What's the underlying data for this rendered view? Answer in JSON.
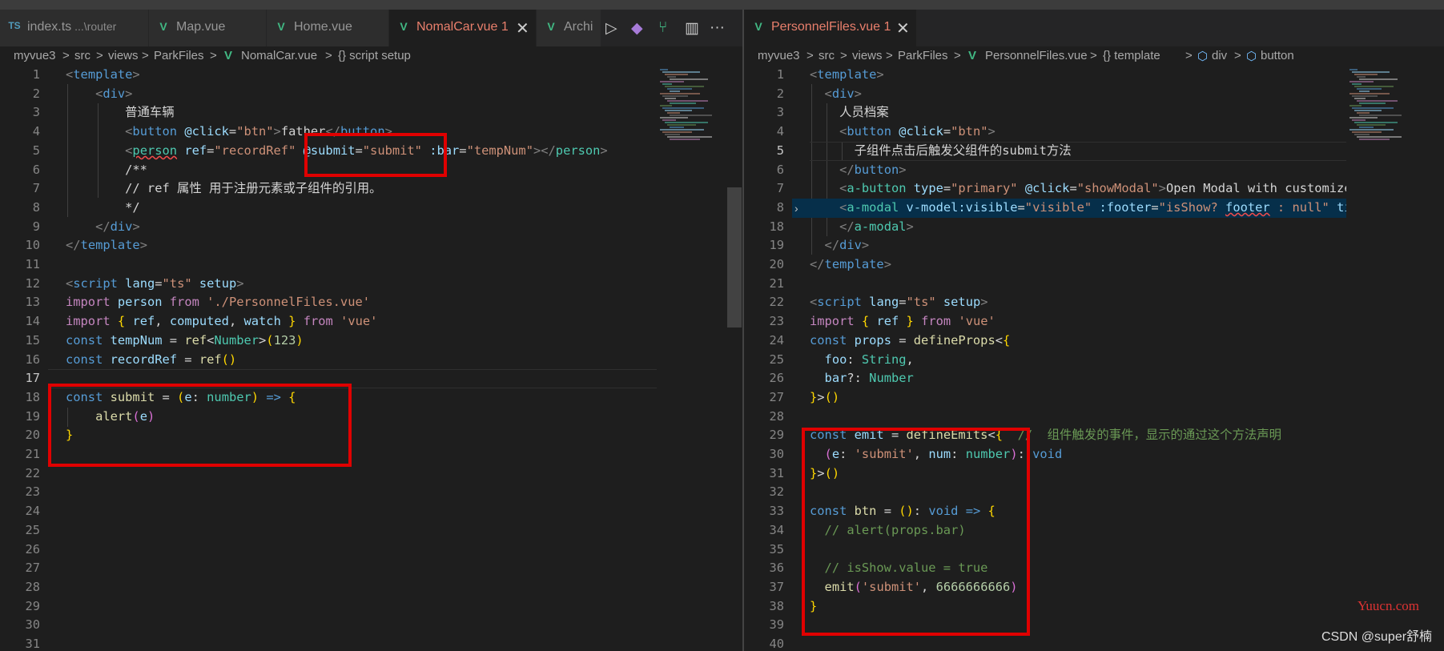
{
  "left": {
    "tabs": [
      {
        "icon": "TS",
        "label": "index.ts",
        "sub": "...\\router",
        "active": false
      },
      {
        "icon": "V",
        "label": "Map.vue",
        "active": false
      },
      {
        "icon": "V",
        "label": "Home.vue",
        "active": false
      },
      {
        "icon": "V",
        "label": "NomalCar.vue",
        "badge": "1",
        "active": true,
        "close": "✕"
      },
      {
        "icon": "V",
        "label": "Archi",
        "active": false
      }
    ],
    "actions": [
      "▷",
      "◆",
      "⑂",
      "▥",
      "···"
    ],
    "breadcrumb": [
      "myvue3",
      ">",
      "src",
      ">",
      "views",
      ">",
      "ParkFiles",
      ">",
      "NomalCar.vue",
      ">",
      "{} script setup"
    ],
    "line_numbers": [
      "1",
      "2",
      "3",
      "4",
      "5",
      "6",
      "7",
      "8",
      "9",
      "10",
      "11",
      "12",
      "13",
      "14",
      "15",
      "16",
      "17",
      "18",
      "19",
      "20",
      "21",
      "22",
      "23",
      "24",
      "25",
      "26",
      "27",
      "28",
      "29",
      "30",
      "31"
    ],
    "current_line": "17",
    "code": [
      [
        [
          "t",
          "<"
        ],
        [
          "tag",
          "template"
        ],
        [
          "t",
          ">"
        ]
      ],
      [
        [
          "txt",
          "    "
        ],
        [
          "t",
          "<"
        ],
        [
          "tag",
          "div"
        ],
        [
          "t",
          ">"
        ]
      ],
      [
        [
          "txt",
          "        普通车辆"
        ]
      ],
      [
        [
          "txt",
          "        "
        ],
        [
          "t",
          "<"
        ],
        [
          "tag",
          "button"
        ],
        [
          "txt",
          " "
        ],
        [
          "attr",
          "@click"
        ],
        [
          "txt",
          "="
        ],
        [
          "str",
          "\"btn\""
        ],
        [
          "t",
          ">"
        ],
        [
          "txt",
          "father"
        ],
        [
          "t",
          "</"
        ],
        [
          "tag",
          "button"
        ],
        [
          "t",
          ">"
        ]
      ],
      [
        [
          "txt",
          "        "
        ],
        [
          "t",
          "<"
        ],
        [
          "comp squig",
          "person"
        ],
        [
          "txt",
          " "
        ],
        [
          "attr",
          "ref"
        ],
        [
          "txt",
          "="
        ],
        [
          "str",
          "\"recordRef\""
        ],
        [
          "txt",
          " "
        ],
        [
          "attr",
          "@submit"
        ],
        [
          "txt",
          "="
        ],
        [
          "str",
          "\"submit\""
        ],
        [
          "txt",
          " "
        ],
        [
          "attr",
          ":bar"
        ],
        [
          "txt",
          "="
        ],
        [
          "str",
          "\"tempNum\""
        ],
        [
          "t",
          ">"
        ],
        [
          "t",
          "</"
        ],
        [
          "comp",
          "person"
        ],
        [
          "t",
          ">"
        ]
      ],
      [
        [
          "txt",
          "        "
        ],
        [
          "txt",
          "/**"
        ]
      ],
      [
        [
          "txt",
          "        // ref 属性 用于注册元素或子组件的引用。"
        ]
      ],
      [
        [
          "txt",
          "        */"
        ]
      ],
      [
        [
          "txt",
          "    "
        ],
        [
          "t",
          "</"
        ],
        [
          "tag",
          "div"
        ],
        [
          "t",
          ">"
        ]
      ],
      [
        [
          "t",
          "</"
        ],
        [
          "tag",
          "template"
        ],
        [
          "t",
          ">"
        ]
      ],
      [],
      [
        [
          "t",
          "<"
        ],
        [
          "tag",
          "script"
        ],
        [
          "txt",
          " "
        ],
        [
          "attr",
          "lang"
        ],
        [
          "txt",
          "="
        ],
        [
          "str",
          "\"ts\""
        ],
        [
          "txt",
          " "
        ],
        [
          "attr",
          "setup"
        ],
        [
          "t",
          ">"
        ]
      ],
      [
        [
          "kw2",
          "import"
        ],
        [
          "txt",
          " "
        ],
        [
          "var",
          "person"
        ],
        [
          "txt",
          " "
        ],
        [
          "kw2",
          "from"
        ],
        [
          "txt",
          " "
        ],
        [
          "str",
          "'./PersonnelFiles.vue'"
        ]
      ],
      [
        [
          "kw2",
          "import"
        ],
        [
          "txt",
          " "
        ],
        [
          "yb",
          "{"
        ],
        [
          "txt",
          " "
        ],
        [
          "var",
          "ref"
        ],
        [
          "txt",
          ", "
        ],
        [
          "var",
          "computed"
        ],
        [
          "txt",
          ", "
        ],
        [
          "var",
          "watch"
        ],
        [
          "txt",
          " "
        ],
        [
          "yb",
          "}"
        ],
        [
          "txt",
          " "
        ],
        [
          "kw2",
          "from"
        ],
        [
          "txt",
          " "
        ],
        [
          "str",
          "'vue'"
        ]
      ],
      [
        [
          "kw",
          "const"
        ],
        [
          "txt",
          " "
        ],
        [
          "var",
          "tempNum"
        ],
        [
          "txt",
          " = "
        ],
        [
          "fn",
          "ref"
        ],
        [
          "txt",
          "<"
        ],
        [
          "type",
          "Number"
        ],
        [
          "txt",
          ">"
        ],
        [
          "yb",
          "("
        ],
        [
          "num",
          "123"
        ],
        [
          "yb",
          ")"
        ]
      ],
      [
        [
          "kw",
          "const"
        ],
        [
          "txt",
          " "
        ],
        [
          "var",
          "recordRef"
        ],
        [
          "txt",
          " = "
        ],
        [
          "fn",
          "ref"
        ],
        [
          "yb",
          "()"
        ]
      ],
      [],
      [
        [
          "kw",
          "const"
        ],
        [
          "txt",
          " "
        ],
        [
          "fn",
          "submit"
        ],
        [
          "txt",
          " = "
        ],
        [
          "yb",
          "("
        ],
        [
          "var",
          "e"
        ],
        [
          "txt",
          ": "
        ],
        [
          "type",
          "number"
        ],
        [
          "yb",
          ")"
        ],
        [
          "txt",
          " "
        ],
        [
          "kw",
          "=>"
        ],
        [
          "txt",
          " "
        ],
        [
          "yb",
          "{"
        ]
      ],
      [
        [
          "txt",
          "    "
        ],
        [
          "fn",
          "alert"
        ],
        [
          "pb",
          "("
        ],
        [
          "var",
          "e"
        ],
        [
          "pb",
          ")"
        ]
      ],
      [
        [
          "yb",
          "}"
        ]
      ],
      [],
      [],
      [],
      [],
      [],
      [],
      [],
      [],
      [],
      [],
      []
    ]
  },
  "right": {
    "tabs": [
      {
        "icon": "V",
        "label": "PersonnelFiles.vue",
        "badge": "1",
        "active": true,
        "close": "✕"
      }
    ],
    "breadcrumb": [
      "myvue3",
      ">",
      "src",
      ">",
      "views",
      ">",
      "ParkFiles",
      ">",
      "PersonnelFiles.vue",
      ">",
      "{} template",
      ">",
      "div",
      ">",
      "button"
    ],
    "line_numbers": [
      "1",
      "2",
      "3",
      "4",
      "5",
      "6",
      "7",
      "8",
      "18",
      "19",
      "20",
      "21",
      "22",
      "23",
      "24",
      "25",
      "26",
      "27",
      "28",
      "29",
      "30",
      "31",
      "32",
      "33",
      "34",
      "35",
      "36",
      "37",
      "38",
      "39",
      "40"
    ],
    "current_line": "5",
    "code": [
      [
        [
          "t",
          "<"
        ],
        [
          "tag",
          "template"
        ],
        [
          "t",
          ">"
        ]
      ],
      [
        [
          "txt",
          "  "
        ],
        [
          "t",
          "<"
        ],
        [
          "tag",
          "div"
        ],
        [
          "t",
          ">"
        ]
      ],
      [
        [
          "txt",
          "    人员档案"
        ]
      ],
      [
        [
          "txt",
          "    "
        ],
        [
          "t",
          "<"
        ],
        [
          "tag",
          "button"
        ],
        [
          "txt",
          " "
        ],
        [
          "attr",
          "@click"
        ],
        [
          "txt",
          "="
        ],
        [
          "str",
          "\"btn\""
        ],
        [
          "t",
          ">"
        ]
      ],
      [
        [
          "txt",
          "      子组件点击后触发父组件的submit方法"
        ]
      ],
      [
        [
          "txt",
          "    "
        ],
        [
          "t",
          "</"
        ],
        [
          "tag",
          "button"
        ],
        [
          "t",
          ">"
        ]
      ],
      [
        [
          "txt",
          "    "
        ],
        [
          "t",
          "<"
        ],
        [
          "comp",
          "a-button"
        ],
        [
          "txt",
          " "
        ],
        [
          "attr",
          "type"
        ],
        [
          "txt",
          "="
        ],
        [
          "str",
          "\"primary\""
        ],
        [
          "txt",
          " "
        ],
        [
          "attr",
          "@click"
        ],
        [
          "txt",
          "="
        ],
        [
          "str",
          "\"showModal\""
        ],
        [
          "t",
          ">"
        ],
        [
          "txt",
          "Open Modal with customized footer"
        ]
      ],
      [
        [
          "txt",
          "    "
        ],
        [
          "t",
          "<"
        ],
        [
          "comp",
          "a-modal"
        ],
        [
          "txt",
          " "
        ],
        [
          "attr",
          "v-model:visible"
        ],
        [
          "txt",
          "="
        ],
        [
          "str",
          "\"visible\""
        ],
        [
          "txt",
          " "
        ],
        [
          "attr",
          ":footer"
        ],
        [
          "txt",
          "="
        ],
        [
          "str",
          "\"isShow? "
        ],
        [
          "var squig",
          "footer"
        ],
        [
          "str",
          " : null\""
        ],
        [
          "txt",
          " "
        ],
        [
          "attr",
          "title"
        ],
        [
          "txt",
          "="
        ]
      ],
      [
        [
          "txt",
          "    "
        ],
        [
          "t",
          "</"
        ],
        [
          "comp",
          "a-modal"
        ],
        [
          "t",
          ">"
        ]
      ],
      [
        [
          "txt",
          "  "
        ],
        [
          "t",
          "</"
        ],
        [
          "tag",
          "div"
        ],
        [
          "t",
          ">"
        ]
      ],
      [
        [
          "t",
          "</"
        ],
        [
          "tag",
          "template"
        ],
        [
          "t",
          ">"
        ]
      ],
      [],
      [
        [
          "t",
          "<"
        ],
        [
          "tag",
          "script"
        ],
        [
          "txt",
          " "
        ],
        [
          "attr",
          "lang"
        ],
        [
          "txt",
          "="
        ],
        [
          "str",
          "\"ts\""
        ],
        [
          "txt",
          " "
        ],
        [
          "attr",
          "setup"
        ],
        [
          "t",
          ">"
        ]
      ],
      [
        [
          "kw2",
          "import"
        ],
        [
          "txt",
          " "
        ],
        [
          "yb",
          "{"
        ],
        [
          "txt",
          " "
        ],
        [
          "var",
          "ref"
        ],
        [
          "txt",
          " "
        ],
        [
          "yb",
          "}"
        ],
        [
          "txt",
          " "
        ],
        [
          "kw2",
          "from"
        ],
        [
          "txt",
          " "
        ],
        [
          "str",
          "'vue'"
        ]
      ],
      [
        [
          "kw",
          "const"
        ],
        [
          "txt",
          " "
        ],
        [
          "var",
          "props"
        ],
        [
          "txt",
          " = "
        ],
        [
          "fn",
          "defineProps"
        ],
        [
          "txt",
          "<"
        ],
        [
          "yb",
          "{"
        ]
      ],
      [
        [
          "txt",
          "  "
        ],
        [
          "var",
          "foo"
        ],
        [
          "txt",
          ": "
        ],
        [
          "type",
          "String"
        ],
        [
          "txt",
          ","
        ]
      ],
      [
        [
          "txt",
          "  "
        ],
        [
          "var",
          "bar"
        ],
        [
          "txt",
          "?: "
        ],
        [
          "type",
          "Number"
        ]
      ],
      [
        [
          "yb",
          "}"
        ],
        [
          "txt",
          ">"
        ],
        [
          "yb",
          "()"
        ]
      ],
      [],
      [
        [
          "kw",
          "const"
        ],
        [
          "txt",
          " "
        ],
        [
          "var",
          "emit"
        ],
        [
          "txt",
          " = "
        ],
        [
          "fn",
          "defineEmits"
        ],
        [
          "txt",
          "<"
        ],
        [
          "yb",
          "{"
        ],
        [
          "txt",
          "  "
        ],
        [
          "cm",
          "//  组件触发的事件，显示的通过这个方法声明"
        ]
      ],
      [
        [
          "txt",
          "  "
        ],
        [
          "pb",
          "("
        ],
        [
          "var",
          "e"
        ],
        [
          "txt",
          ": "
        ],
        [
          "str",
          "'submit'"
        ],
        [
          "txt",
          ", "
        ],
        [
          "var",
          "num"
        ],
        [
          "txt",
          ": "
        ],
        [
          "type",
          "number"
        ],
        [
          "pb",
          ")"
        ],
        [
          "txt",
          ": "
        ],
        [
          "kw",
          "void"
        ]
      ],
      [
        [
          "yb",
          "}"
        ],
        [
          "txt",
          ">"
        ],
        [
          "yb",
          "()"
        ]
      ],
      [],
      [
        [
          "kw",
          "const"
        ],
        [
          "txt",
          " "
        ],
        [
          "fn",
          "btn"
        ],
        [
          "txt",
          " = "
        ],
        [
          "yb",
          "()"
        ],
        [
          "txt",
          ": "
        ],
        [
          "kw",
          "void"
        ],
        [
          "txt",
          " "
        ],
        [
          "kw",
          "=>"
        ],
        [
          "txt",
          " "
        ],
        [
          "yb",
          "{"
        ]
      ],
      [
        [
          "txt",
          "  "
        ],
        [
          "cm",
          "// alert(props.bar)"
        ]
      ],
      [],
      [
        [
          "txt",
          "  "
        ],
        [
          "cm",
          "// isShow.value = true"
        ]
      ],
      [
        [
          "txt",
          "  "
        ],
        [
          "fn",
          "emit"
        ],
        [
          "pb",
          "("
        ],
        [
          "str",
          "'submit'"
        ],
        [
          "txt",
          ", "
        ],
        [
          "num",
          "6666666666"
        ],
        [
          "pb",
          ")"
        ]
      ],
      [
        [
          "yb",
          "}"
        ]
      ],
      [],
      []
    ]
  },
  "watermark": {
    "site": "Yuucn.com",
    "csdn": "CSDN @super舒楠"
  },
  "colors": {
    "highlight": "#e00000",
    "editor_bg": "#1e1e1e",
    "tabbar_bg": "#252526",
    "modified_tab": "#e97f6c",
    "vue": "#41b883"
  }
}
